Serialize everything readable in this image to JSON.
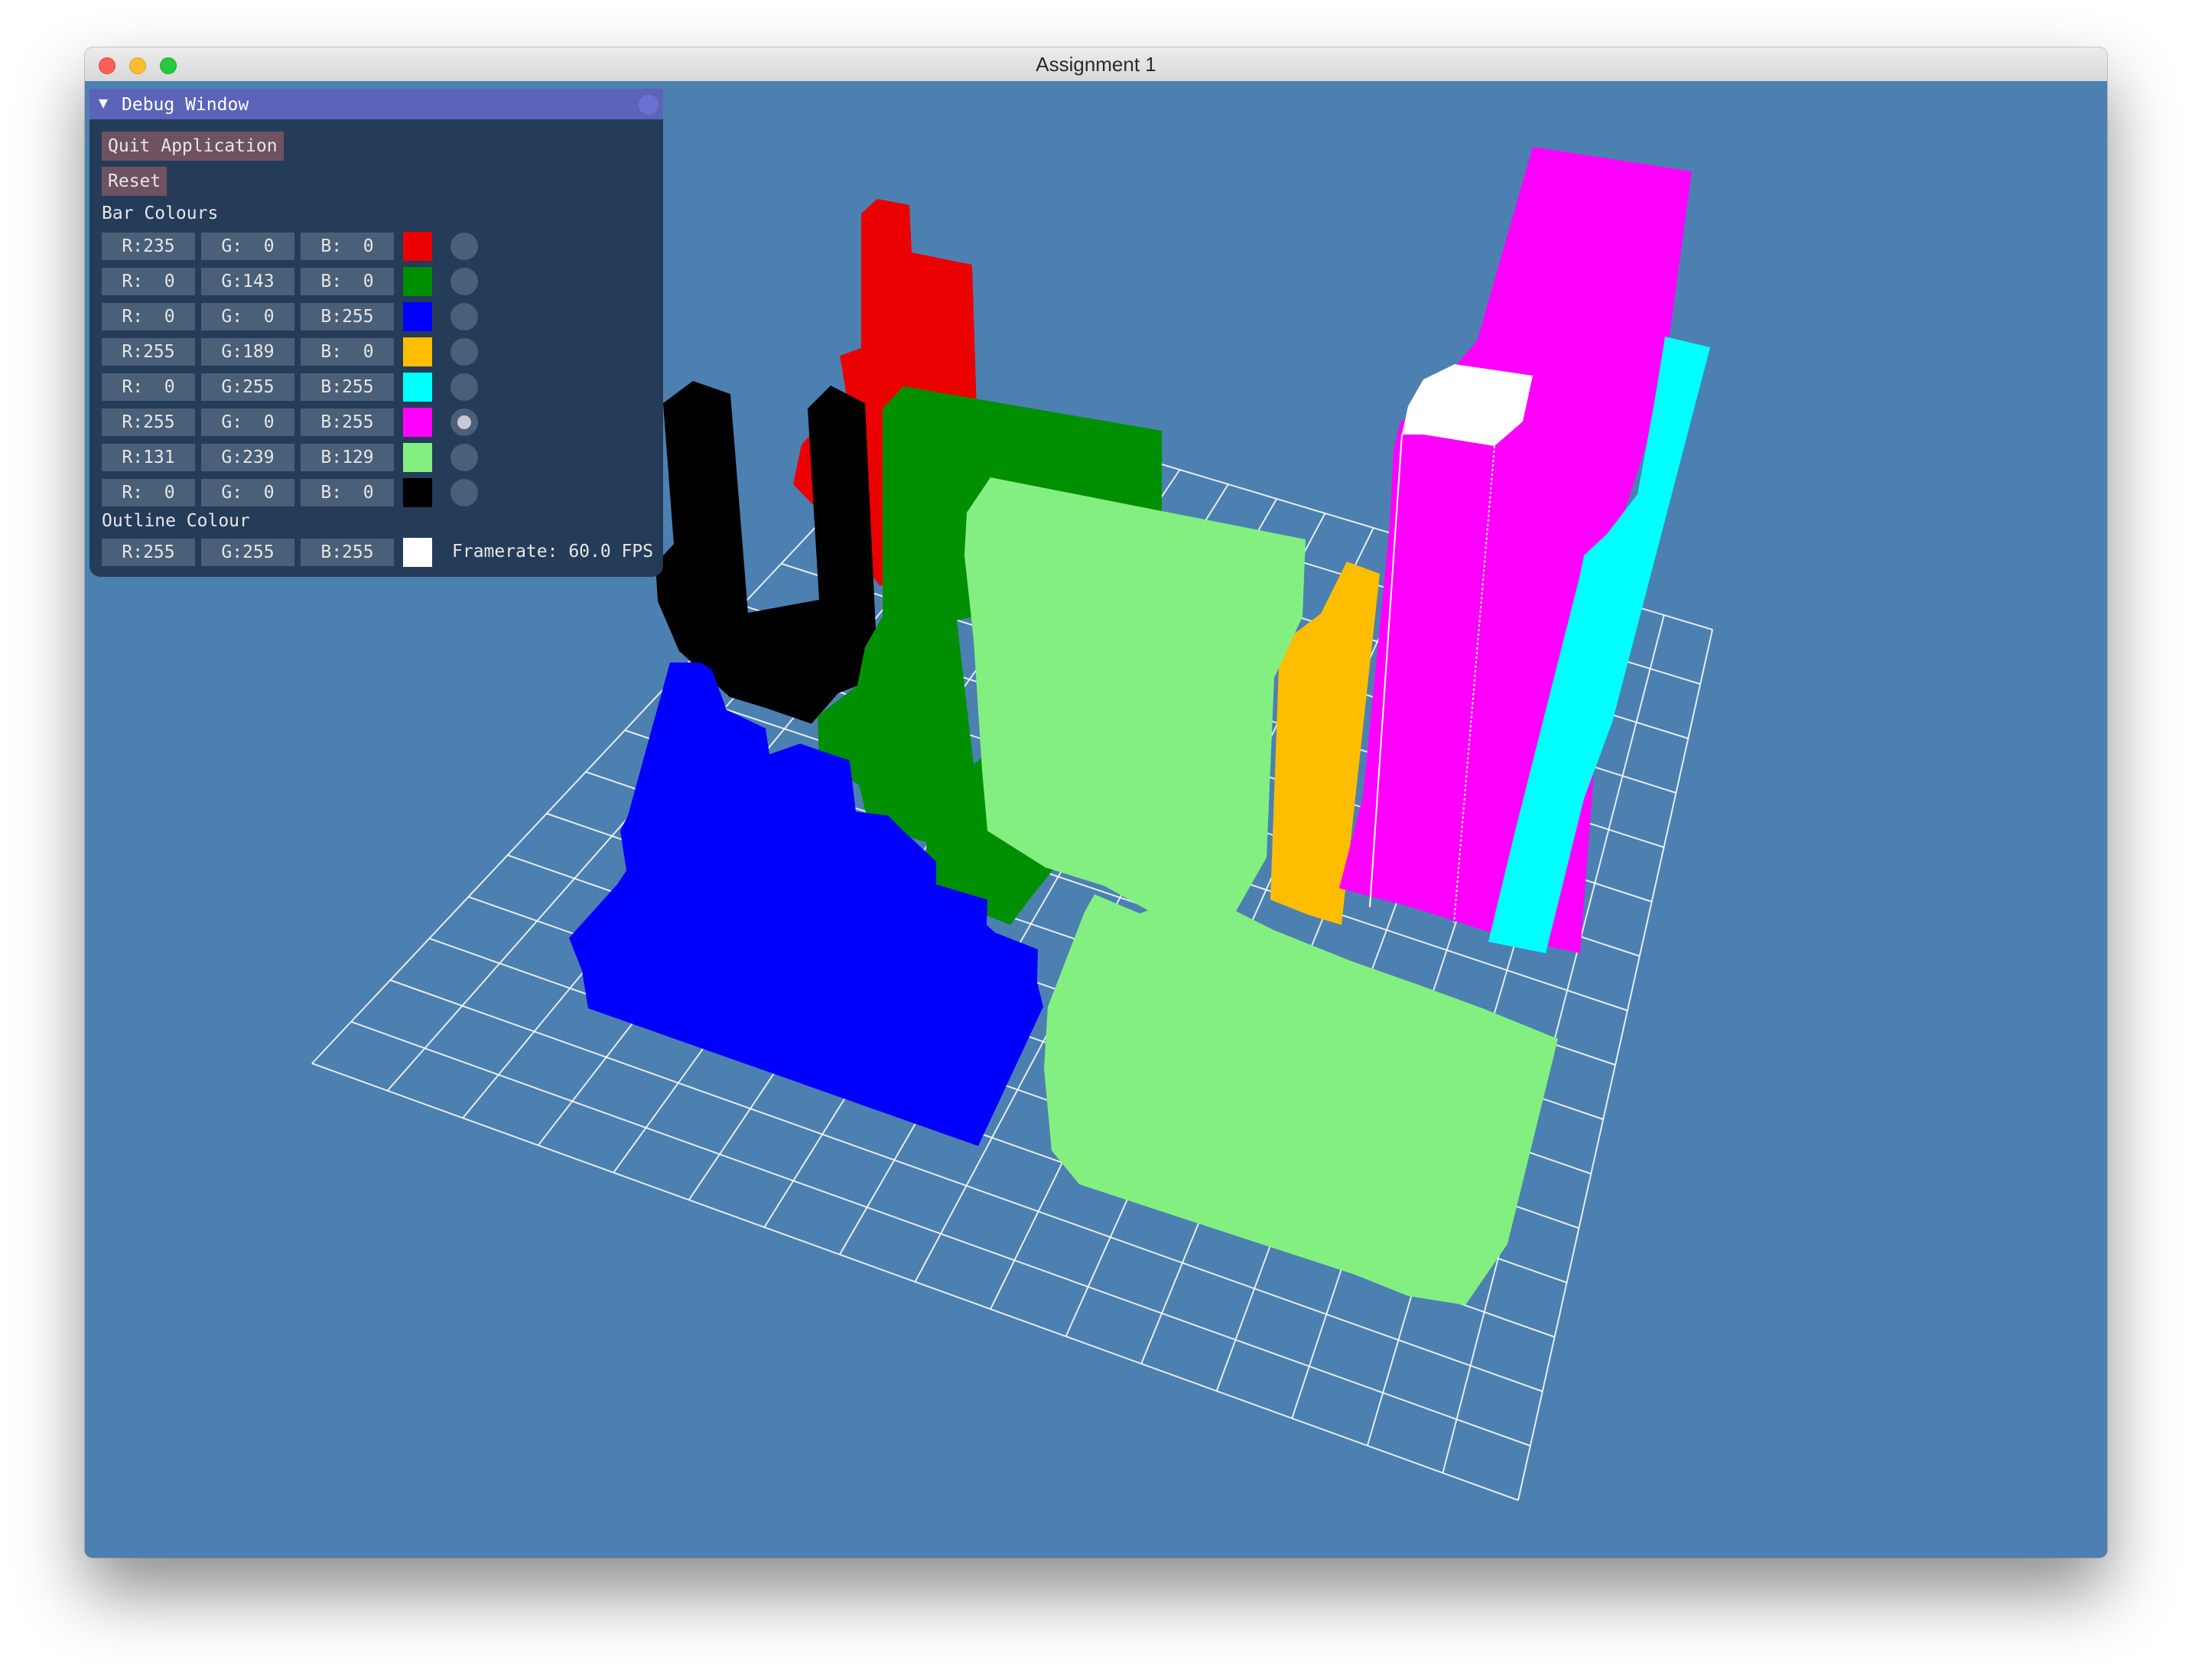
{
  "window": {
    "title": "Assignment 1"
  },
  "debug": {
    "title": "Debug Window",
    "collapse_arrow": "▼",
    "quit_label": "Quit Application",
    "reset_label": "Reset",
    "bar_colours_label": "Bar Colours",
    "outline_colour_label": "Outline Colour",
    "framerate_text": "Framerate: 60.0 FPS",
    "bar_colours": [
      {
        "r": "R:235",
        "g": "G:  0",
        "b": "B:  0",
        "hex": "#eb0000",
        "selected": false
      },
      {
        "r": "R:  0",
        "g": "G:143",
        "b": "B:  0",
        "hex": "#008f00",
        "selected": false
      },
      {
        "r": "R:  0",
        "g": "G:  0",
        "b": "B:255",
        "hex": "#0000ff",
        "selected": false
      },
      {
        "r": "R:255",
        "g": "G:189",
        "b": "B:  0",
        "hex": "#ffbd00",
        "selected": false
      },
      {
        "r": "R:  0",
        "g": "G:255",
        "b": "B:255",
        "hex": "#00ffff",
        "selected": false
      },
      {
        "r": "R:255",
        "g": "G:  0",
        "b": "B:255",
        "hex": "#ff00ff",
        "selected": true
      },
      {
        "r": "R:131",
        "g": "G:239",
        "b": "B:129",
        "hex": "#83ef81",
        "selected": false
      },
      {
        "r": "R:  0",
        "g": "G:  0",
        "b": "B:  0",
        "hex": "#000000",
        "selected": false
      }
    ],
    "outline": {
      "r": "R:255",
      "g": "G:255",
      "b": "B:255",
      "hex": "#ffffff"
    }
  },
  "colors": {
    "viewport_background": "#4c80b1",
    "grid_lines": "#ffffff"
  }
}
